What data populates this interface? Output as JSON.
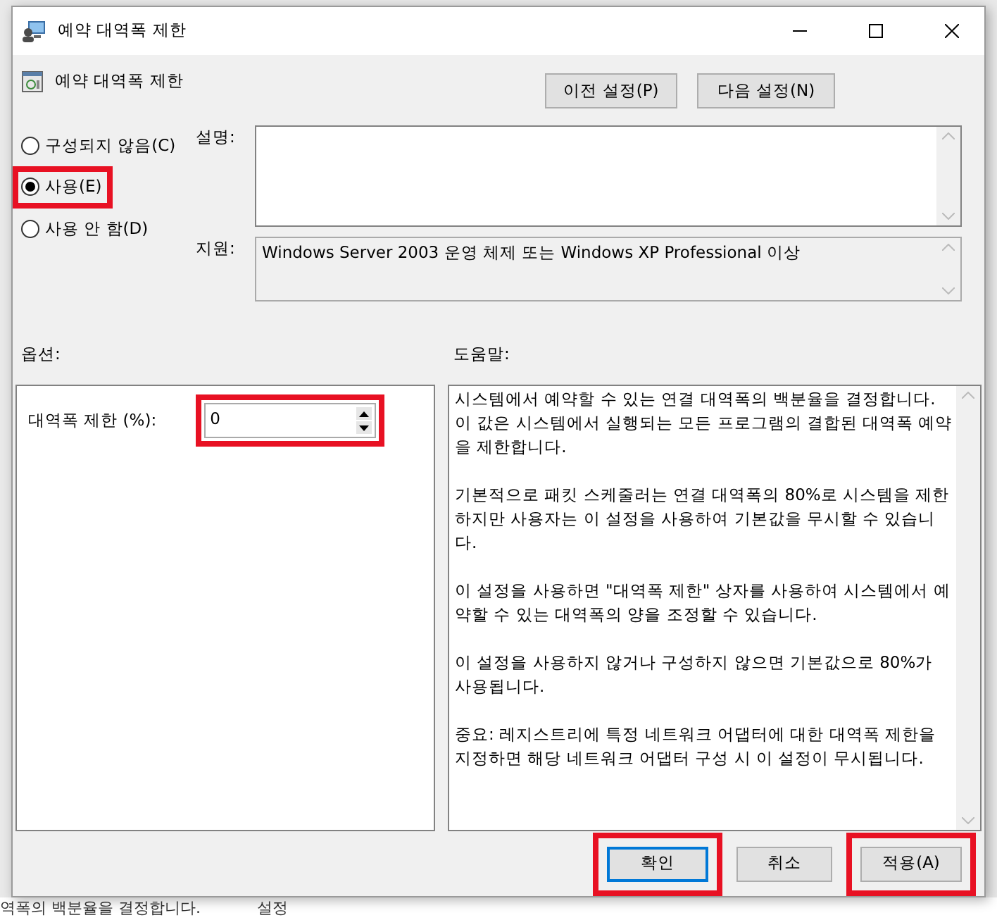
{
  "background_window": {
    "bottom_text": "역폭의 백분율을 결정합니다.",
    "bottom_label": "설정"
  },
  "window": {
    "title": "예약 대역폭 제한"
  },
  "header": {
    "title": "예약 대역폭 제한",
    "buttons": [
      {
        "label": "이전 설정(P)"
      },
      {
        "label": "다음 설정(N)"
      }
    ]
  },
  "state_options": [
    {
      "label": "구성되지 않음(C)",
      "selected": false,
      "highlighted": false
    },
    {
      "label": "사용(E)",
      "selected": true,
      "highlighted": true
    },
    {
      "label": "사용 안 함(D)",
      "selected": false,
      "highlighted": false
    }
  ],
  "comment": {
    "label": "설명:"
  },
  "supported": {
    "label": "지원:",
    "value": "Windows Server 2003 운영 체제 또는 Windows XP Professional 이상"
  },
  "options": {
    "heading": "옵션:",
    "fields": [
      {
        "label": "대역폭 제한 (%):",
        "value": "0",
        "highlighted": true
      }
    ]
  },
  "help": {
    "heading": "도움말:",
    "paragraphs": [
      "시스템에서 예약할 수 있는 연결 대역폭의 백분율을 결정합니다. 이 값은 시스템에서 실행되는 모든 프로그램의 결합된 대역폭 예약을 제한합니다.",
      "기본적으로 패킷 스케줄러는 연결 대역폭의 80%로 시스템을 제한하지만 사용자는 이 설정을 사용하여 기본값을 무시할 수 있습니다.",
      "이 설정을 사용하면 \"대역폭 제한\" 상자를 사용하여 시스템에서 예약할 수 있는 대역폭의 양을 조정할 수 있습니다.",
      "이 설정을 사용하지 않거나 구성하지 않으면 기본값으로 80%가 사용됩니다.",
      "중요: 레지스트리에 특정 네트워크 어댑터에 대한 대역폭 제한을 지정하면 해당 네트워크 어댑터 구성 시 이 설정이 무시됩니다."
    ]
  },
  "footer_buttons": [
    {
      "label": "확인",
      "kind": "default",
      "highlighted": true
    },
    {
      "label": "취소",
      "kind": "normal",
      "highlighted": false
    },
    {
      "label": "적용(A)",
      "kind": "normal",
      "highlighted": true
    }
  ]
}
